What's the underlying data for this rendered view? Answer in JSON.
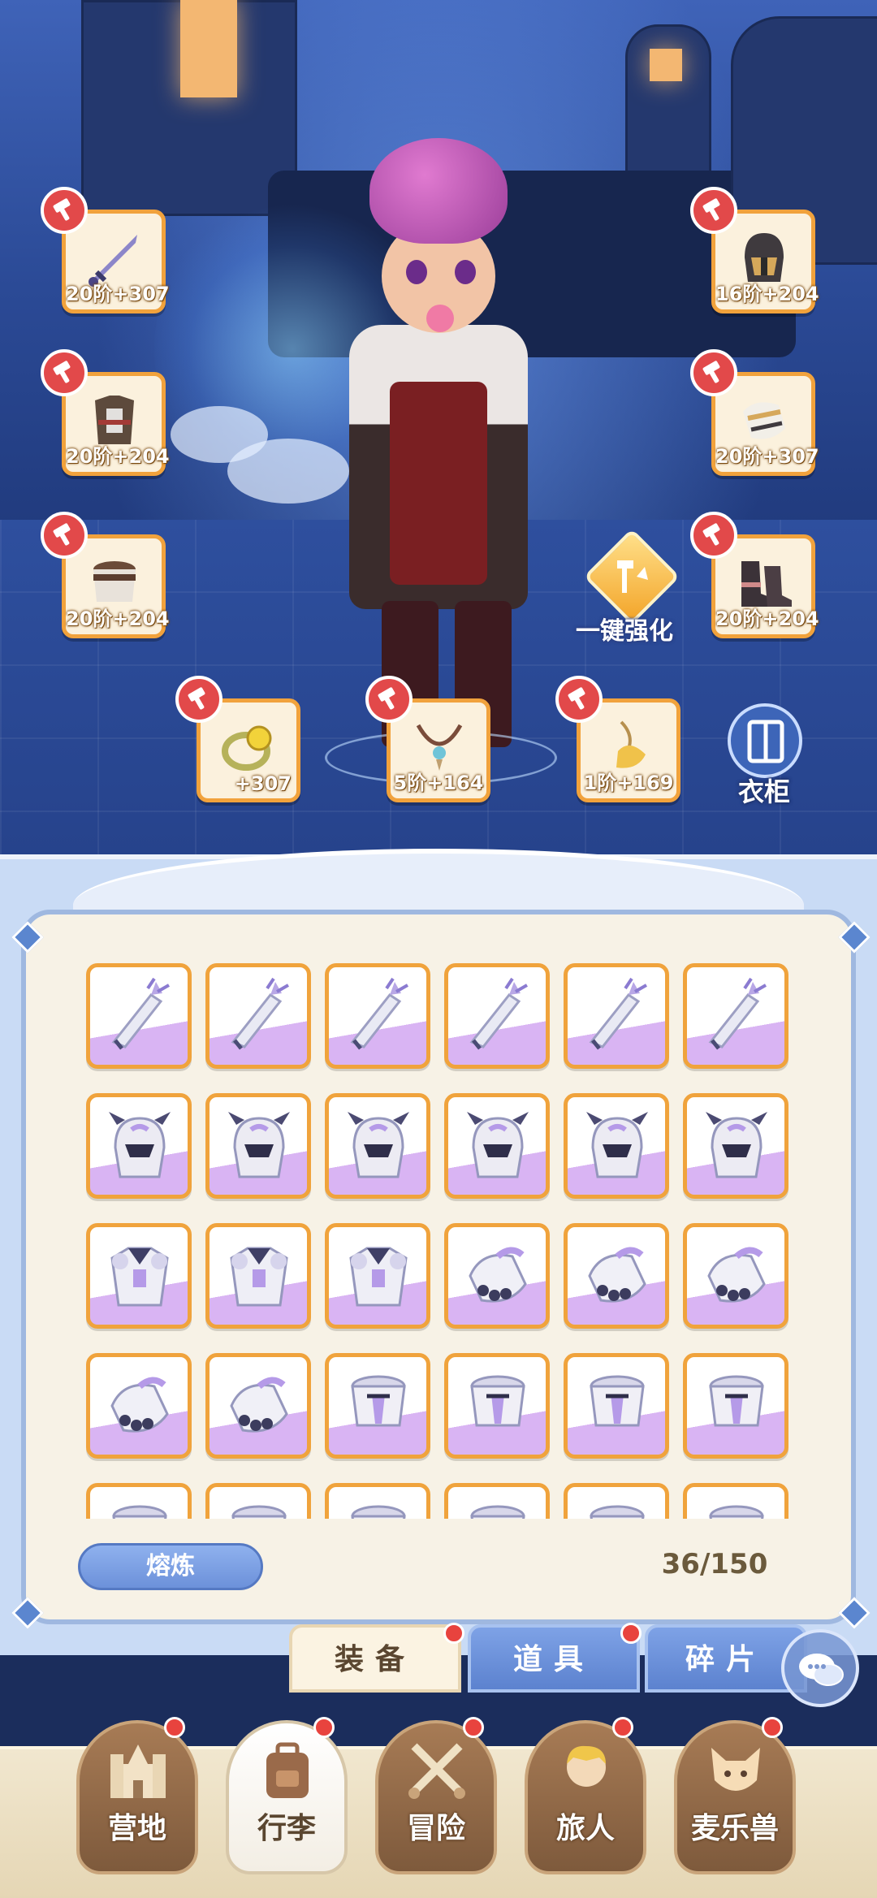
{
  "equipment": {
    "left": [
      {
        "name": "weapon-slot",
        "level": "20阶",
        "bonus": "+307",
        "icon": "sword-icon"
      },
      {
        "name": "armor-slot",
        "level": "20阶",
        "bonus": "+204",
        "icon": "chest-armor-icon"
      },
      {
        "name": "belt-slot",
        "level": "20阶",
        "bonus": "+204",
        "icon": "waist-armor-icon"
      }
    ],
    "right": [
      {
        "name": "helmet-slot",
        "level": "16阶",
        "bonus": "+204",
        "icon": "helmet-icon"
      },
      {
        "name": "gauntlet-slot",
        "level": "20阶",
        "bonus": "+307",
        "icon": "gauntlet-icon"
      },
      {
        "name": "boots-slot",
        "level": "20阶",
        "bonus": "+204",
        "icon": "boots-icon"
      }
    ],
    "bottom": [
      {
        "name": "ring-slot",
        "level": "",
        "bonus": "+307",
        "icon": "ring-icon"
      },
      {
        "name": "necklace-slot",
        "level": "5阶",
        "bonus": "+164",
        "icon": "necklace-icon"
      },
      {
        "name": "amulet-slot",
        "level": "1阶",
        "bonus": "+169",
        "icon": "amulet-icon"
      }
    ],
    "one_click_enhance": "一键强化",
    "wardrobe": "衣柜",
    "accent_color": "#f1a23c",
    "hammer_color": "#e2494a"
  },
  "inventory": {
    "rows": [
      [
        "gauntlet-blade",
        "gauntlet-blade",
        "gauntlet-blade",
        "gauntlet-blade",
        "gauntlet-blade",
        "gauntlet-blade"
      ],
      [
        "helmet",
        "helmet",
        "helmet",
        "helmet",
        "helmet",
        "helmet"
      ],
      [
        "chest-armor",
        "chest-armor",
        "chest-armor",
        "gauntlet",
        "gauntlet",
        "gauntlet"
      ],
      [
        "gauntlet",
        "gauntlet",
        "belt",
        "belt",
        "belt",
        "belt"
      ],
      [
        "belt",
        "belt",
        "belt",
        "belt",
        "belt",
        "belt"
      ]
    ],
    "smelt_button": "熔炼",
    "capacity": "36/150"
  },
  "tabs": [
    {
      "label": "装备",
      "active": true
    },
    {
      "label": "道具",
      "active": false
    },
    {
      "label": "碎片",
      "active": false
    }
  ],
  "nav": [
    {
      "label": "营地",
      "icon": "castle-icon",
      "active": false
    },
    {
      "label": "行李",
      "icon": "backpack-icon",
      "active": true
    },
    {
      "label": "冒险",
      "icon": "crossed-swords-icon",
      "active": false
    },
    {
      "label": "旅人",
      "icon": "traveler-icon",
      "active": false
    },
    {
      "label": "麦乐兽",
      "icon": "pet-icon",
      "active": false
    }
  ]
}
